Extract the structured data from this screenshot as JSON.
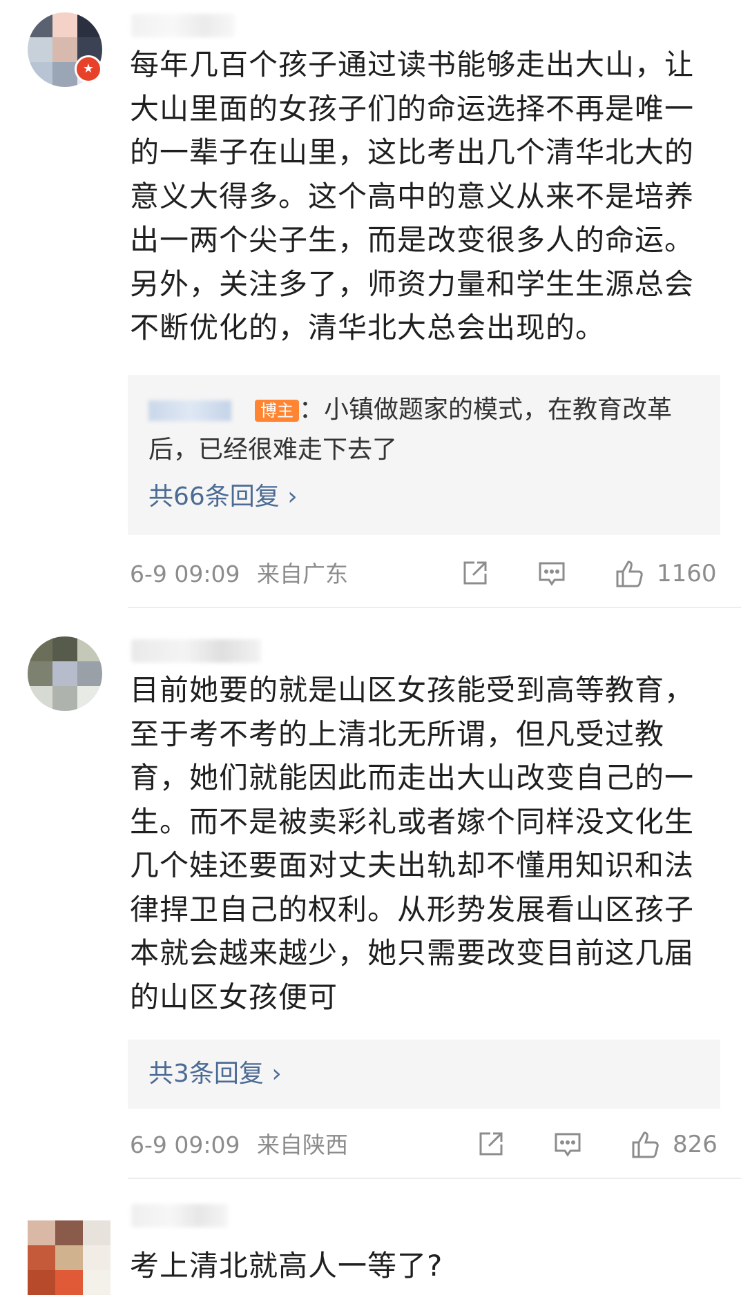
{
  "comments": [
    {
      "body": "每年几百个孩子通过读书能够走出大山，让大山里面的女孩子们的命运选择不再是唯一的一辈子在山里，这比考出几个清华北大的意义大得多。这个高中的意义从来不是培养出一两个尖子生，而是改变很多人的命运。另外，关注多了，师资力量和学生生源总会不断优化的，清华北大总会出现的。",
      "reply": {
        "host_label": "博主",
        "text": "：小镇做题家的模式，在教育改革后，已经很难走下去了"
      },
      "more_replies": "共66条回复 ›",
      "time": "6-9 09:09",
      "location": "来自广东",
      "likes": "1160"
    },
    {
      "body": "目前她要的就是山区女孩能受到高等教育，至于考不考的上清北无所谓，但凡受过教育，她们就能因此而走出大山改变自己的一生。而不是被卖彩礼或者嫁个同样没文化生几个娃还要面对丈夫出轨却不懂用知识和法律捍卫自己的权利。从形势发展看山区孩子本就会越来越少，她只需要改变目前这几届的山区女孩便可",
      "more_replies": "共3条回复 ›",
      "time": "6-9 09:09",
      "location": "来自陕西",
      "likes": "826"
    },
    {
      "body": "考上清北就高人一等了?"
    }
  ],
  "icons": {
    "share": "share-icon",
    "comment": "comment-icon",
    "like": "thumbs-up-icon",
    "verified": "verified-badge-icon"
  },
  "colors": {
    "link": "#4b6b94",
    "host_tag": "#ff8533",
    "verified_badge": "#e8412a",
    "meta": "#8c8c8c"
  }
}
